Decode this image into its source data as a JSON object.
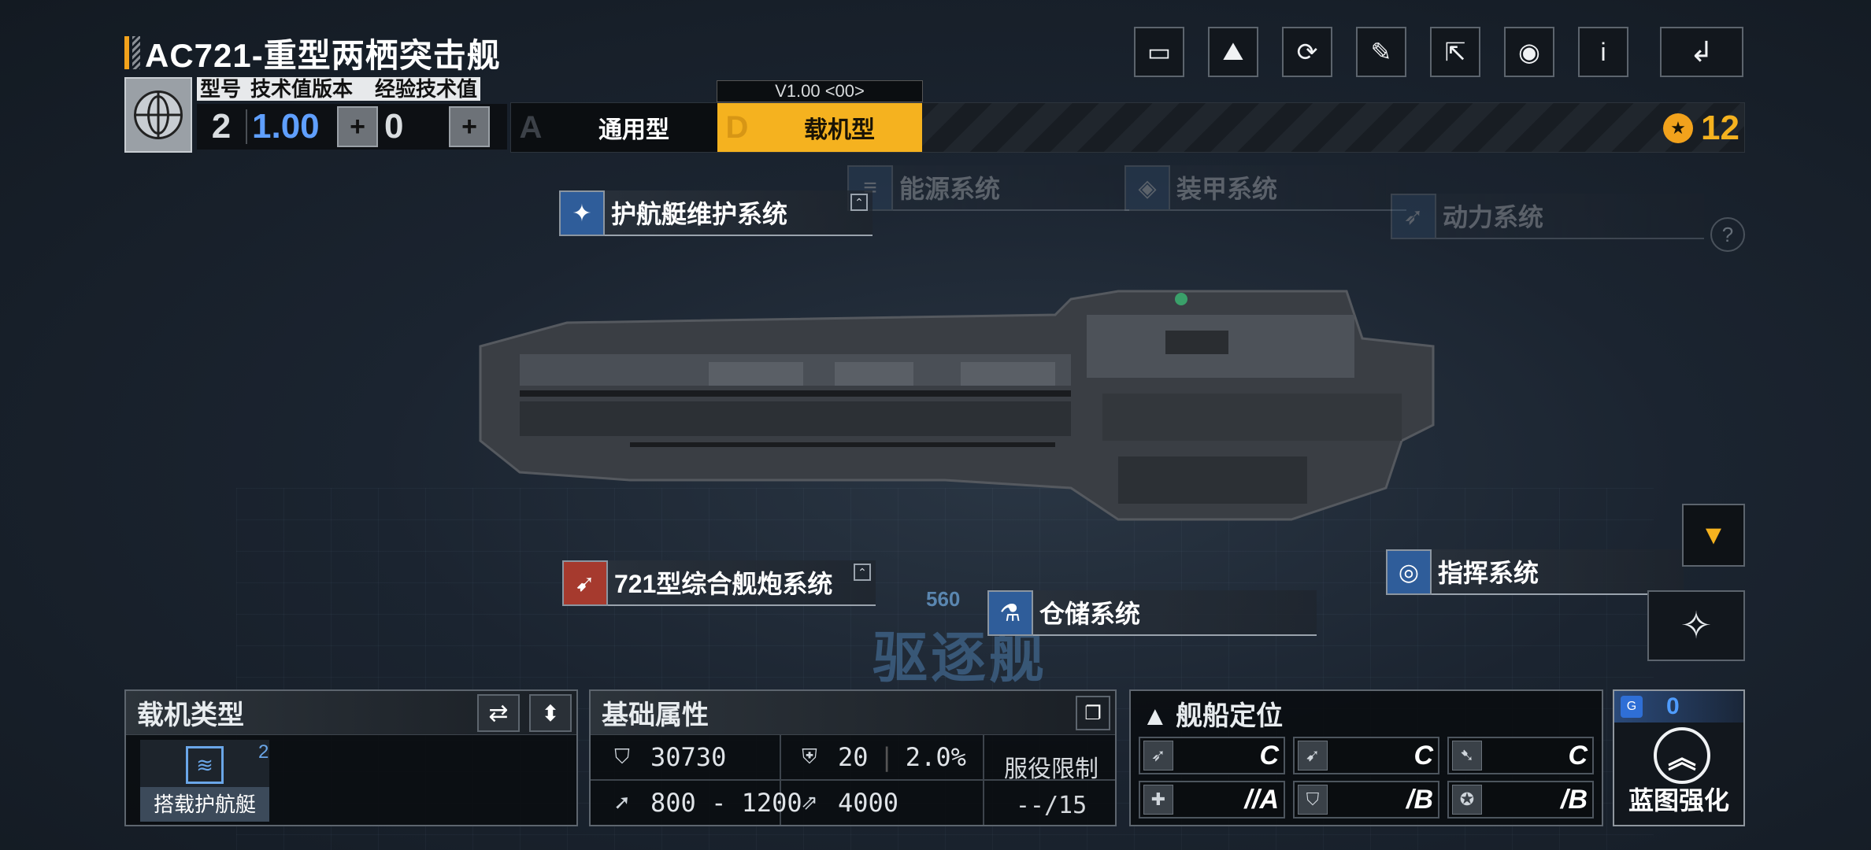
{
  "header": {
    "title": "AC721-重型两栖突击舰",
    "labels": {
      "model": "型号",
      "tech_version": "技术值版本",
      "exp_tech": "经验技术值"
    },
    "values": {
      "model": "2",
      "tech_version": "1.00",
      "exp_tech": "0"
    }
  },
  "variants": {
    "version_tag": "V1.00 <00>",
    "tab_a": {
      "letter": "A",
      "label": "通用型"
    },
    "tab_d": {
      "letter": "D",
      "label": "载机型"
    }
  },
  "medal": {
    "value": "12"
  },
  "toolbar": [
    "camera-icon",
    "gallery-icon",
    "refresh-icon",
    "paint-icon",
    "share-icon",
    "view-icon",
    "info-icon"
  ],
  "systems": {
    "escort_maintenance": "护航艇维护系统",
    "energy": "能源系统",
    "armor": "装甲系统",
    "power": "动力系统",
    "artillery": "721型综合舰炮系统",
    "command": "指挥系统",
    "storage": "仓储系统"
  },
  "scene": {
    "ship_class": "驱逐舰",
    "distance": "560"
  },
  "carrier_panel": {
    "title": "载机类型",
    "item_name": "搭载护航艇",
    "item_count": "2"
  },
  "attributes_panel": {
    "title": "基础属性",
    "hp": "30730",
    "armor_val": "20",
    "armor_pct": "2.0%",
    "speed": "800 - 1200",
    "warp": "4000",
    "service_title": "服役限制",
    "service_value": "--/15"
  },
  "positioning_panel": {
    "title": "舰船定位",
    "grades": [
      "C",
      "C",
      "C",
      "//A",
      "/B",
      "/B"
    ]
  },
  "blueprint_panel": {
    "count": "0",
    "label": "蓝图强化"
  },
  "colors": {
    "accent": "#f5b21f",
    "blue": "#5f9fff",
    "panel_border": "#5d656e"
  }
}
